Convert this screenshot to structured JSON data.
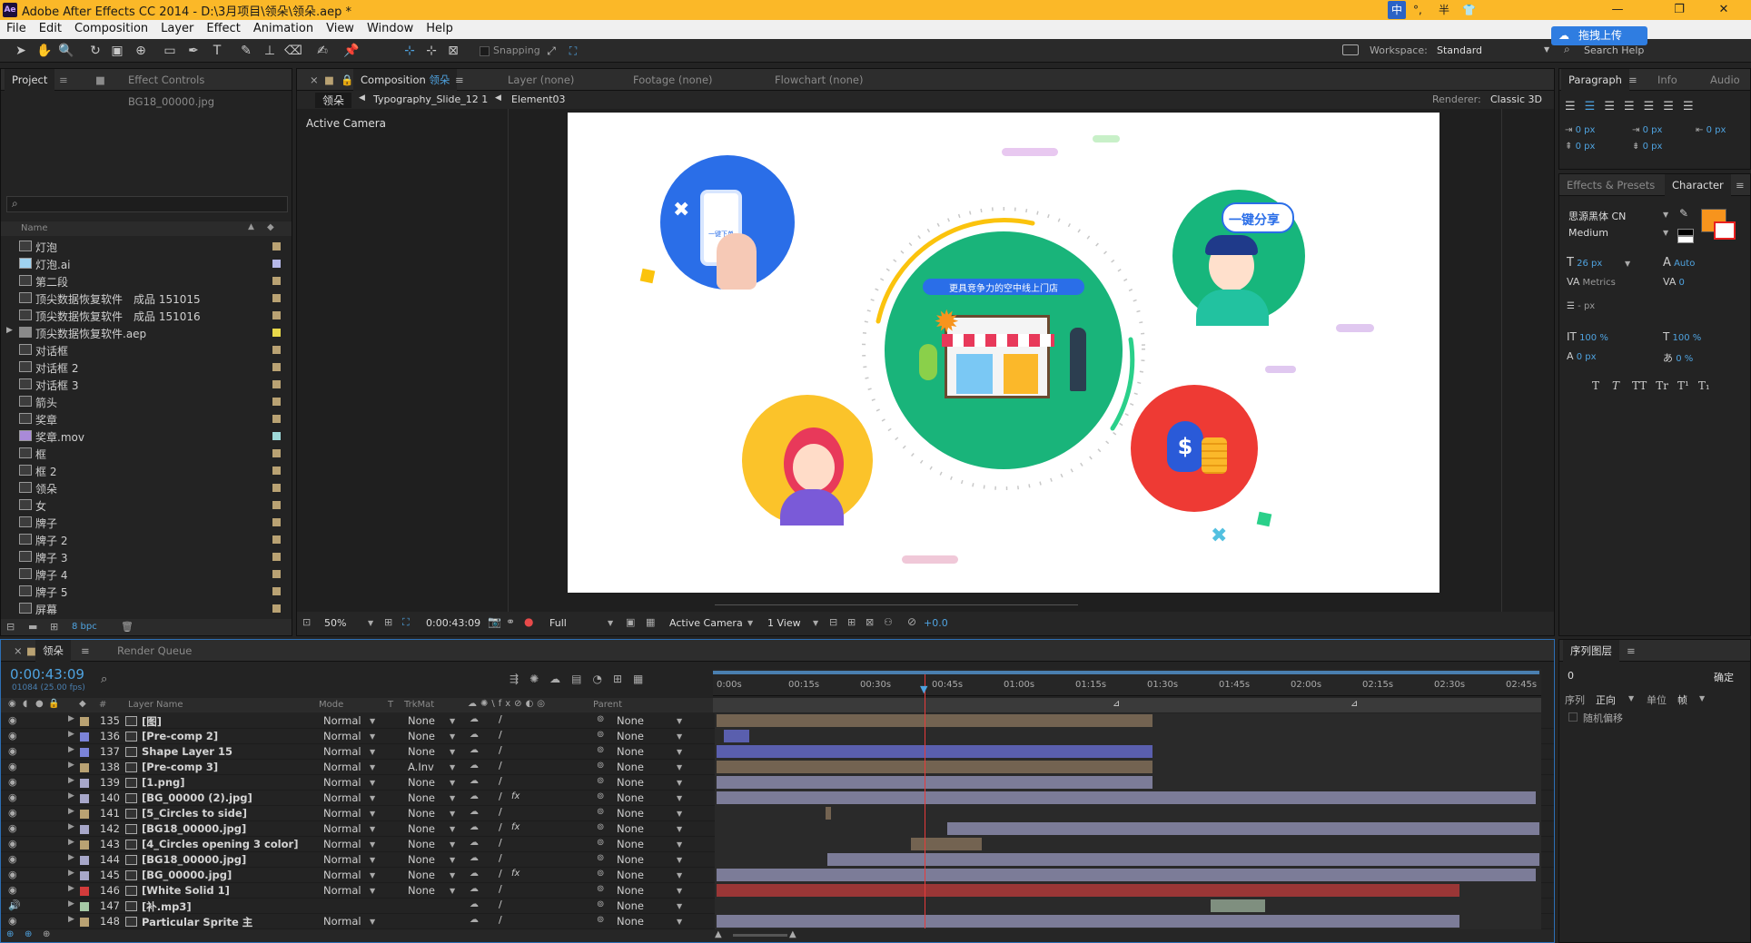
{
  "window": {
    "title": "Adobe After Effects CC 2014 - D:\\3月项目\\领朵\\领朵.aep *",
    "app_icon": "Ae",
    "minimize": "—",
    "maximize": "❐",
    "close": "✕",
    "ime": {
      "lang": "中",
      "punct": "°,",
      "width": "半",
      "shirt": "shirt-icon"
    },
    "upload_btn": "拖拽上传"
  },
  "menu": [
    "File",
    "Edit",
    "Composition",
    "Layer",
    "Effect",
    "Animation",
    "View",
    "Window",
    "Help"
  ],
  "toolbar": {
    "snapping": "Snapping",
    "workspace_label": "Workspace:",
    "workspace": "Standard",
    "search": "Search Help"
  },
  "project": {
    "tab": "Project",
    "tab2": "Effect Controls BG18_00000.jpg",
    "col_name": "Name",
    "bpc": "8 bpc",
    "items": [
      "灯泡",
      "灯泡.ai",
      "第二段",
      "顶尖数据恢复软件　成品 151015",
      "顶尖数据恢复软件　成品 151016",
      "顶尖数据恢复软件.aep",
      "对话框",
      "对话框 2",
      "对话框 3",
      "箭头",
      "奖章",
      "奖章.mov",
      "框",
      "框 2",
      "领朵",
      "女",
      "牌子",
      "牌子 2",
      "牌子 3",
      "牌子 4",
      "牌子 5",
      "屏幕"
    ]
  },
  "comp": {
    "tab": "Composition",
    "tab_name": "领朵",
    "tab_layer": "Layer (none)",
    "tab_footage": "Footage (none)",
    "tab_flowchart": "Flowchart (none)",
    "breadcrumbs": [
      "领朵",
      "Typography_Slide_12 1",
      "Element03"
    ],
    "renderer_label": "Renderer:",
    "renderer": "Classic 3D",
    "active_camera": "Active Camera",
    "canvas_text_banner": "更具竞争力的空中线上门店",
    "canvas_text_share": "一键分享",
    "canvas_text_phone": "一键下单",
    "footer": {
      "zoom": "50%",
      "time": "0:00:43:09",
      "res": "Full",
      "camera": "Active Camera",
      "views": "1 View",
      "exposure": "+0.0"
    }
  },
  "right": {
    "tabs": [
      "Paragraph",
      "Info",
      "Audio"
    ],
    "tabs2": [
      "Effects & Presets",
      "Character"
    ],
    "font": "思源黑体 CN",
    "weight": "Medium",
    "px0": "0 px",
    "size": "26 px",
    "leading": "Auto",
    "kerning": "Metrics",
    "tracking": "0",
    "unit_px": "- px",
    "vscale": "100 %",
    "hscale": "100 %",
    "baseline": "0 px",
    "tsume": "0 %",
    "fill_color": "#f7941d",
    "styles": [
      "T",
      "T",
      "TT",
      "Tr",
      "T¹",
      "T₁"
    ],
    "seq_title": "序列图层",
    "seq_value": "0",
    "seq_confirm": "确定",
    "seq_order": "序列",
    "seq_dir": "正向",
    "seq_unit": "单位",
    "seq_frame": "帧",
    "seq_random": "随机偏移"
  },
  "timeline": {
    "tab": "领朵",
    "tab2": "Render Queue",
    "time": "0:00:43:09",
    "fps": "01084 (25.00 fps)",
    "cols": {
      "layer": "Layer Name",
      "mode": "Mode",
      "t": "T",
      "trk": "TrkMat",
      "parent": "Parent"
    },
    "ticks": [
      "0:00s",
      "00:15s",
      "00:30s",
      "00:45s",
      "01:00s",
      "01:15s",
      "01:30s",
      "01:45s",
      "02:00s",
      "02:15s",
      "02:30s",
      "02:45s"
    ],
    "layers": [
      {
        "num": "135",
        "name": "[图]",
        "mode": "Normal",
        "trk": "None",
        "parent": "None",
        "color": "#b9a273"
      },
      {
        "num": "136",
        "name": "[Pre-comp 2]",
        "mode": "Normal",
        "trk": "None",
        "parent": "None",
        "color": "#7b83d8"
      },
      {
        "num": "137",
        "name": "Shape Layer 15",
        "mode": "Normal",
        "trk": "None",
        "parent": "None",
        "color": "#7b83d8"
      },
      {
        "num": "138",
        "name": "[Pre-comp 3]",
        "mode": "Normal",
        "trk": "A.Inv",
        "parent": "None",
        "color": "#b9a273"
      },
      {
        "num": "139",
        "name": "[1.png]",
        "mode": "Normal",
        "trk": "None",
        "parent": "None",
        "color": "#a7a7c9"
      },
      {
        "num": "140",
        "name": "[BG_00000 (2).jpg]",
        "mode": "Normal",
        "trk": "None",
        "parent": "None",
        "color": "#a7a7c9"
      },
      {
        "num": "141",
        "name": "[5_Circles to side]",
        "mode": "Normal",
        "trk": "None",
        "parent": "None",
        "color": "#b9a273"
      },
      {
        "num": "142",
        "name": "[BG18_00000.jpg]",
        "mode": "Normal",
        "trk": "None",
        "parent": "None",
        "color": "#a7a7c9"
      },
      {
        "num": "143",
        "name": "[4_Circles opening 3 color]",
        "mode": "Normal",
        "trk": "None",
        "parent": "None",
        "color": "#b9a273"
      },
      {
        "num": "144",
        "name": "[BG18_00000.jpg]",
        "mode": "Normal",
        "trk": "None",
        "parent": "None",
        "color": "#a7a7c9"
      },
      {
        "num": "145",
        "name": "[BG_00000.jpg]",
        "mode": "Normal",
        "trk": "None",
        "parent": "None",
        "color": "#a7a7c9"
      },
      {
        "num": "146",
        "name": "[White Solid 1]",
        "mode": "Normal",
        "trk": "None",
        "parent": "None",
        "color": "#d23b3b"
      },
      {
        "num": "147",
        "name": "[补.mp3]",
        "mode": "",
        "trk": "",
        "parent": "None",
        "color": "#a6c9a6"
      },
      {
        "num": "148",
        "name": "Particular Sprite 主",
        "mode": "Normal",
        "trk": "",
        "parent": "None",
        "color": "#b9a273"
      }
    ]
  }
}
